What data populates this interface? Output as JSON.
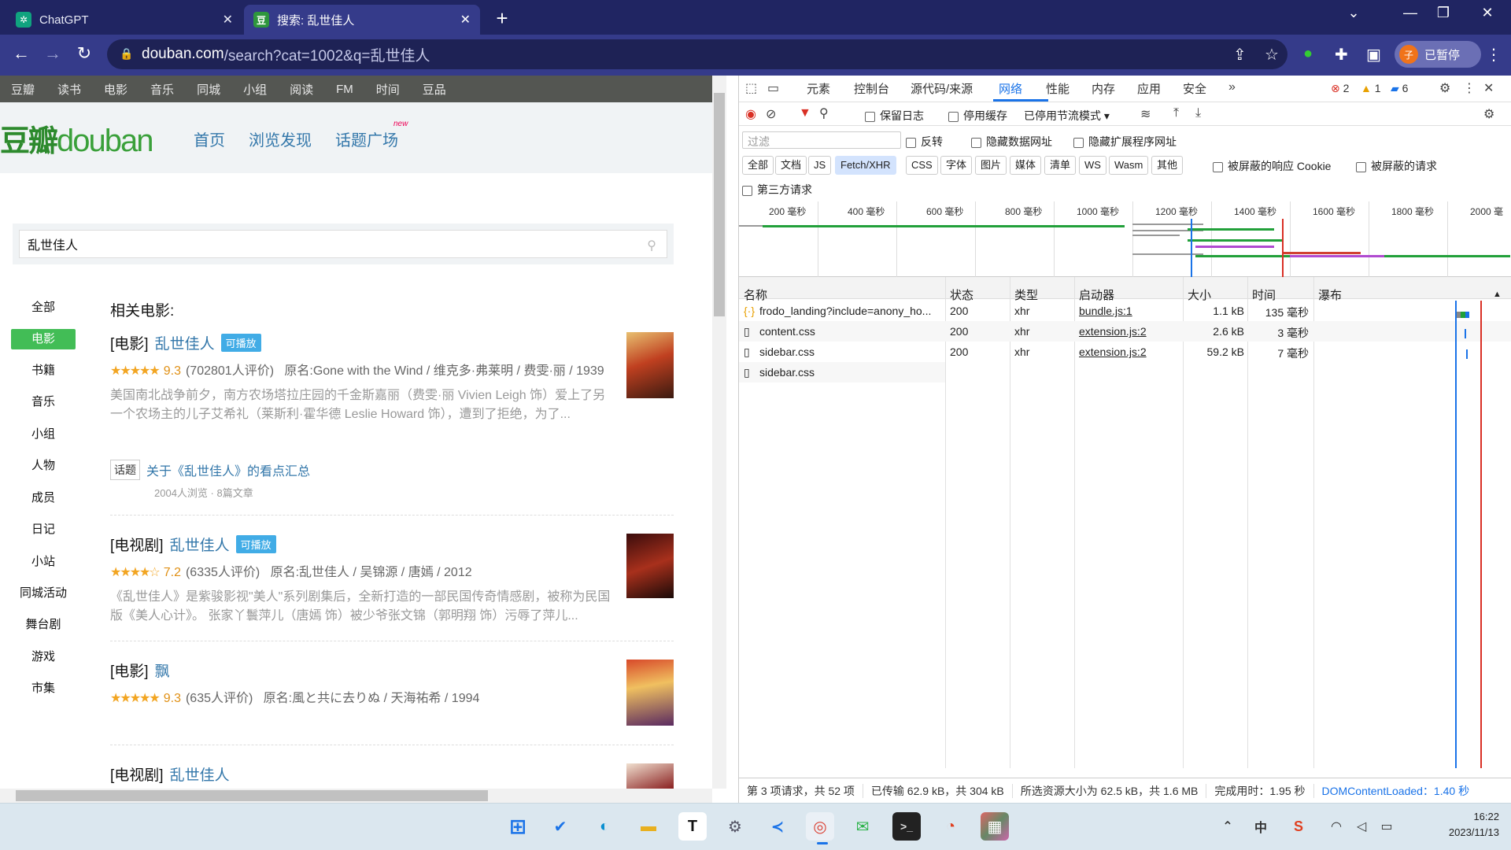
{
  "browser": {
    "tabs": [
      {
        "title": "ChatGPT",
        "active": false
      },
      {
        "title": "搜索: 乱世佳人",
        "active": true
      }
    ],
    "url_domain": "douban.com",
    "url_rest": "/search?cat=1002&q=乱世佳人",
    "paused_label": "已暂停",
    "avatar_letter": "子"
  },
  "douban": {
    "topnav": [
      "豆瓣",
      "读书",
      "电影",
      "音乐",
      "同城",
      "小组",
      "阅读",
      "FM",
      "时间",
      "豆品"
    ],
    "logo_cn": "豆瓣",
    "logo_en": "douban",
    "headnav": [
      "首页",
      "浏览发现",
      "话题广场"
    ],
    "new_badge": "new",
    "search_value": "乱世佳人",
    "categories": [
      "全部",
      "电影",
      "书籍",
      "音乐",
      "小组",
      "人物",
      "成员",
      "日记",
      "小站",
      "同城活动",
      "舞台剧",
      "游戏",
      "市集"
    ],
    "active_category": "电影",
    "section_title": "相关电影:",
    "results": [
      {
        "kind": "[电影]",
        "title": "乱世佳人",
        "badge": "可播放",
        "stars": "★★★★★",
        "rating": "9.3",
        "count": "(702801人评价)",
        "meta": "原名:Gone with the Wind / 维克多·弗莱明 / 费雯·丽 / 1939",
        "desc": "美国南北战争前夕，南方农场塔拉庄园的千金斯嘉丽（费雯·丽 Vivien Leigh 饰）爱上了另一个农场主的儿子艾希礼（莱斯利·霍华德 Leslie Howard 饰），遭到了拒绝，为了..."
      },
      {
        "kind": "[电视剧]",
        "title": "乱世佳人",
        "badge": "可播放",
        "stars": "★★★★☆",
        "rating": "7.2",
        "count": "(6335人评价)",
        "meta": "原名:乱世佳人 / 吴锦源 / 唐嫣 / 2012",
        "desc": "《乱世佳人》是紫骏影视\"美人\"系列剧集后，全新打造的一部民国传奇情感剧，被称为民国版《美人心计》。 张家丫鬟萍儿（唐嫣 饰）被少爷张文锦（郭明翔 饰）污辱了萍儿..."
      },
      {
        "kind": "[电影]",
        "title": "飘",
        "badge": "",
        "stars": "★★★★★",
        "rating": "9.3",
        "count": "(635人评价)",
        "meta": "原名:風と共に去りぬ / 天海祐希 / 1994",
        "desc": ""
      },
      {
        "kind": "[电视剧]",
        "title": "乱世佳人",
        "badge": "",
        "stars": "",
        "rating": "",
        "count": "",
        "meta": "",
        "desc": ""
      }
    ],
    "topic": {
      "tag": "话题",
      "title": "关于《乱世佳人》的看点汇总",
      "meta": "2004人浏览 · 8篇文章"
    }
  },
  "devtools": {
    "tabs": [
      "元素",
      "控制台",
      "源代码/来源",
      "网络",
      "性能",
      "内存",
      "应用",
      "安全"
    ],
    "active_tab": "网络",
    "errors": "2",
    "warnings": "1",
    "messages": "6",
    "preserve_log": "保留日志",
    "disable_cache": "停用缓存",
    "throttle": "已停用节流模式",
    "filter_placeholder": "过滤",
    "invert": "反转",
    "hide_data": "隐藏数据网址",
    "hide_ext": "隐藏扩展程序网址",
    "type_chips": [
      "全部",
      "文档",
      "JS",
      "Fetch/XHR",
      "CSS",
      "字体",
      "图片",
      "媒体",
      "清单",
      "WS",
      "Wasm",
      "其他"
    ],
    "active_chip": "Fetch/XHR",
    "blocked_cookies": "被屏蔽的响应 Cookie",
    "blocked_requests": "被屏蔽的请求",
    "third_party": "第三方请求",
    "ticks": [
      "200 毫秒",
      "400 毫秒",
      "600 毫秒",
      "800 毫秒",
      "1000 毫秒",
      "1200 毫秒",
      "1400 毫秒",
      "1600 毫秒",
      "1800 毫秒",
      "2000 毫"
    ],
    "columns": [
      "名称",
      "状态",
      "类型",
      "启动器",
      "大小",
      "时间",
      "瀑布"
    ],
    "rows": [
      {
        "name": "frodo_landing?include=anony_ho...",
        "status": "200",
        "type": "xhr",
        "initiator": "bundle.js:1",
        "size": "1.1 kB",
        "time": "135 毫秒"
      },
      {
        "name": "content.css",
        "status": "200",
        "type": "xhr",
        "initiator": "extension.js:2",
        "size": "2.6 kB",
        "time": "3 毫秒"
      },
      {
        "name": "sidebar.css",
        "status": "200",
        "type": "xhr",
        "initiator": "extension.js:2",
        "size": "59.2 kB",
        "time": "7 毫秒"
      },
      {
        "name": "sidebar.css",
        "status": "",
        "type": "",
        "initiator": "",
        "size": "",
        "time": ""
      }
    ],
    "status": {
      "requests": "第 3 项请求，共 52 项",
      "transferred": "已传输 62.9 kB，共 304 kB",
      "resources": "所选资源大小为 62.5 kB，共 1.6 MB",
      "finish": "完成用时：1.95 秒",
      "dcl": "DOMContentLoaded：1.40 秒"
    }
  },
  "taskbar": {
    "time": "16:22",
    "date": "2023/11/13",
    "ime": "中"
  },
  "colors": {
    "douban_green": "#42bd56",
    "link": "#3377aa",
    "devtools_blue": "#1a73e8",
    "chrome_dark": "#202562"
  }
}
